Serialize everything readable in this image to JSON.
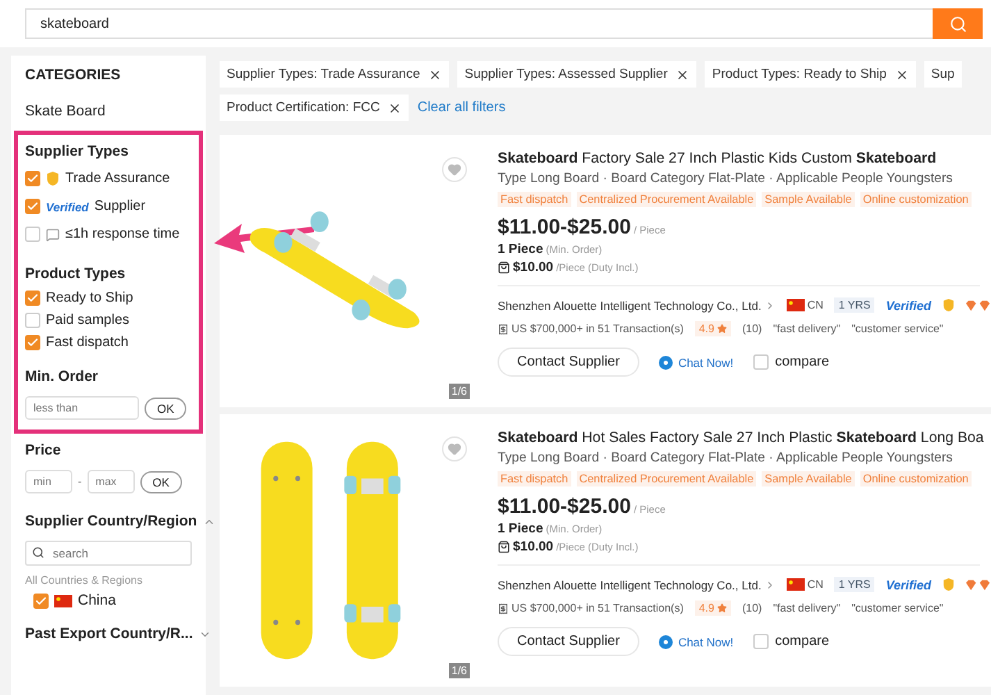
{
  "search": {
    "value": "skateboard"
  },
  "sidebar": {
    "categories_title": "CATEGORIES",
    "category": "Skate Board",
    "supplier_types": {
      "title": "Supplier Types",
      "options": [
        {
          "kind": "trade",
          "label": "Trade Assurance",
          "checked": true
        },
        {
          "kind": "verified",
          "badge": "Verified",
          "label": "Supplier",
          "checked": true
        },
        {
          "kind": "response",
          "label": "≤1h response time",
          "checked": false
        }
      ]
    },
    "product_types": {
      "title": "Product Types",
      "options": [
        {
          "label": "Ready to Ship",
          "checked": true
        },
        {
          "label": "Paid samples",
          "checked": false
        },
        {
          "label": "Fast dispatch",
          "checked": true
        }
      ]
    },
    "min_order": {
      "title": "Min. Order",
      "placeholder": "less than",
      "button": "OK"
    },
    "price": {
      "title": "Price",
      "min_placeholder": "min",
      "separator": "-",
      "max_placeholder": "max",
      "button": "OK"
    },
    "country": {
      "title": "Supplier Country/Region",
      "expanded": true,
      "placeholder": "search",
      "all_label": "All Countries & Regions",
      "options": [
        {
          "label": "China",
          "checked": true
        }
      ]
    },
    "past_export": {
      "title": "Past Export Country/R...",
      "expanded": false
    }
  },
  "filters": {
    "rows": [
      [
        "Supplier Types: Trade Assurance",
        "Supplier Types: Assessed Supplier",
        "Product Types: Ready to Ship",
        "Sup"
      ],
      [
        "Product Certification: FCC"
      ]
    ],
    "clear": "Clear all filters"
  },
  "products": [
    {
      "image_counter": "1/6",
      "favorited": false,
      "title": "**Skateboard** Factory Sale 27 Inch Plastic Kids Custom **Skateboard**",
      "attributes": "Type Long Board · Board Category Flat-Plate · Applicable People Youngsters",
      "tags": [
        "Fast dispatch",
        "Centralized Procurement Available",
        "Sample Available",
        "Online customization"
      ],
      "price": "$11.00-$25.00",
      "unit": "/ Piece",
      "moq": "1 Piece",
      "moq_note": "(Min. Order)",
      "duty_price": "$10.00",
      "duty_note": "/Piece (Duty Incl.)",
      "supplier": "Shenzhen Alouette Intelligent Technology Co., Ltd.",
      "country": "CN",
      "years": "1 YRS",
      "verified": "Verified",
      "transactions": "US $700,000+ in 51 Transaction(s)",
      "rating": "4.9",
      "reviews": "(10)",
      "review_tags": [
        "\"fast delivery\"",
        "\"customer service\""
      ],
      "contact": "Contact Supplier",
      "chat": "Chat Now!",
      "compare": {
        "label": "compare",
        "checked": false
      }
    },
    {
      "image_counter": "1/6",
      "favorited": false,
      "title": "**Skateboard** Hot Sales Factory Sale 27 Inch Plastic **Skateboard** Long Boa",
      "attributes": "Type Long Board · Board Category Flat-Plate · Applicable People Youngsters",
      "tags": [
        "Fast dispatch",
        "Centralized Procurement Available",
        "Sample Available",
        "Online customization"
      ],
      "price": "$11.00-$25.00",
      "unit": "/ Piece",
      "moq": "1 Piece",
      "moq_note": "(Min. Order)",
      "duty_price": "$10.00",
      "duty_note": "/Piece (Duty Incl.)",
      "supplier": "Shenzhen Alouette Intelligent Technology Co., Ltd.",
      "country": "CN",
      "years": "1 YRS",
      "verified": "Verified",
      "transactions": "US $700,000+ in 51 Transaction(s)",
      "rating": "4.9",
      "reviews": "(10)",
      "review_tags": [
        "\"fast delivery\"",
        "\"customer service\""
      ],
      "contact": "Contact Supplier",
      "chat": "Chat Now!",
      "compare": {
        "label": "compare",
        "checked": false
      }
    }
  ]
}
